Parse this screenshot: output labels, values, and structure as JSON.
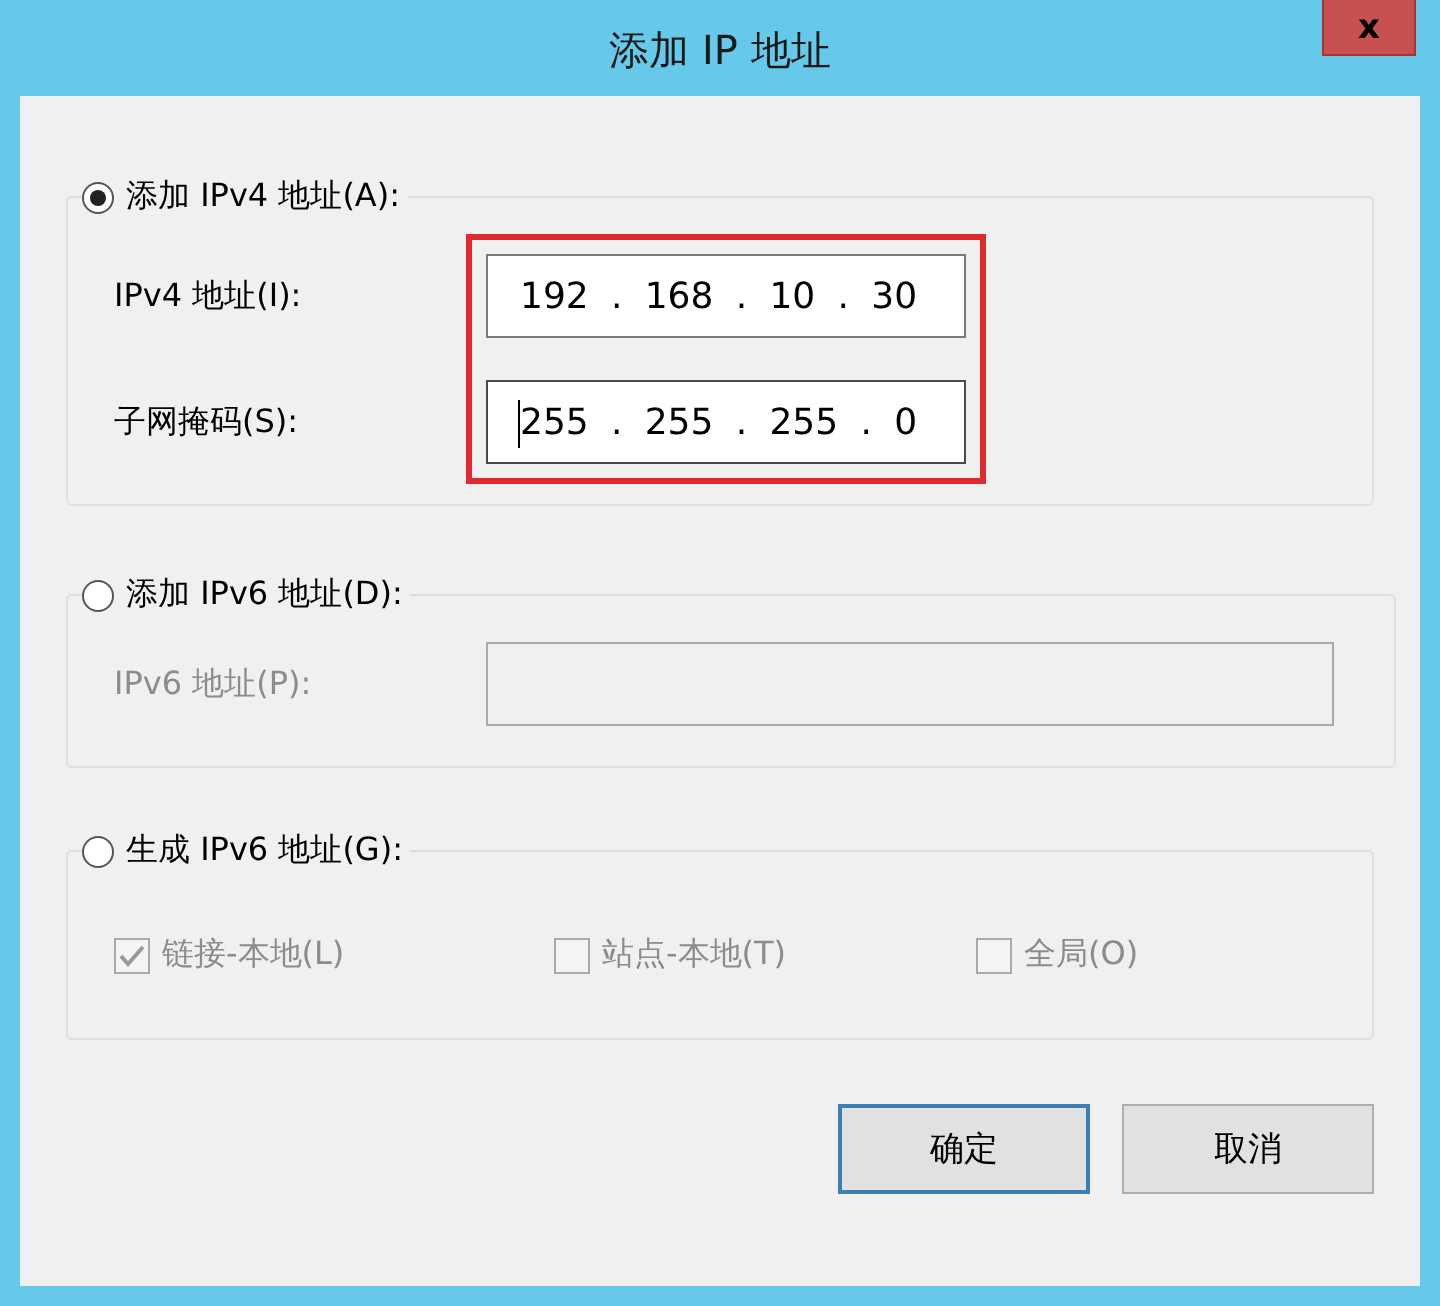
{
  "window": {
    "title": "添加 IP 地址",
    "close": "x"
  },
  "sections": [
    {
      "kind": "ipv4",
      "label": "添加 IPv4 地址(A):",
      "selected": true,
      "highlighted": true,
      "fields": [
        {
          "label": "IPv4 地址(I):",
          "octets": [
            "192",
            "168",
            "10",
            "30"
          ],
          "separator": ".",
          "focused": false
        },
        {
          "label": "子网掩码(S):",
          "octets": [
            "255",
            "255",
            "255",
            "0"
          ],
          "separator": ".",
          "focused": true
        }
      ]
    },
    {
      "kind": "ipv6",
      "label": "添加 IPv6 地址(D):",
      "selected": false,
      "fields": [
        {
          "label": "IPv6 地址(P):",
          "disabled": true
        }
      ]
    },
    {
      "kind": "options",
      "label": "生成 IPv6 地址(G):",
      "selected": false,
      "options": [
        {
          "label": "链接-本地(L)",
          "checked": true,
          "disabled": true
        },
        {
          "label": "站点-本地(T)",
          "checked": false,
          "disabled": true
        },
        {
          "label": "全局(O)",
          "checked": false,
          "disabled": true
        }
      ]
    }
  ],
  "buttons": [
    {
      "label": "确定",
      "default": true
    },
    {
      "label": "取消",
      "default": false
    }
  ]
}
